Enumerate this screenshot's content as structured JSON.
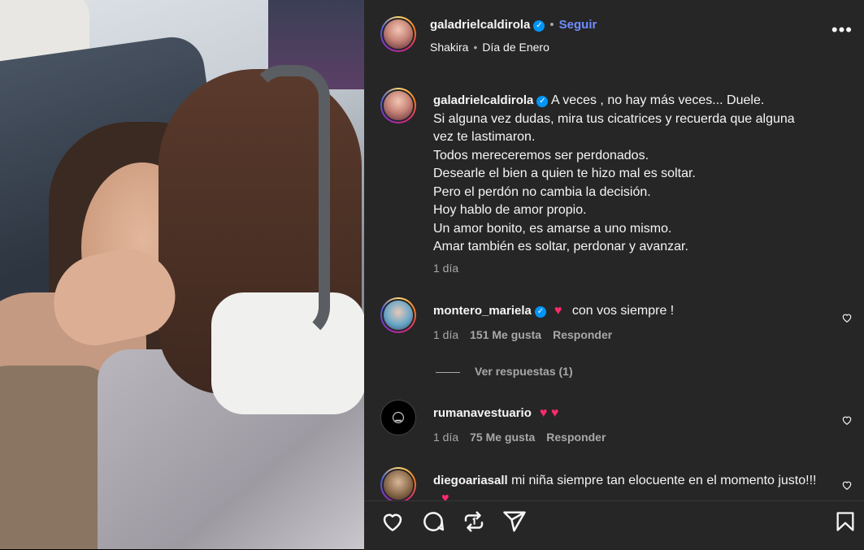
{
  "post": {
    "author": "galadrielcaldirola",
    "follow_label": "Seguir",
    "audio_artist": "Shakira",
    "audio_song": "Día de Enero",
    "more_label": "•••"
  },
  "caption": {
    "author": "galadrielcaldirola",
    "lines": [
      "A veces , no hay más veces... Duele.",
      "Si alguna vez dudas, mira tus cicatrices y recuerda que alguna",
      "vez te lastimaron.",
      "Todos mereceremos ser perdonados.",
      "Desearle el bien a quien te hizo mal es soltar.",
      "Pero el perdón no cambia la decisión.",
      "Hoy hablo de amor propio.",
      "Un amor bonito, es amarse a uno mismo.",
      "Amar también es soltar, perdonar y avanzar."
    ],
    "time": "1 día"
  },
  "comments": [
    {
      "author": "montero_mariela",
      "text": "con vos siempre !",
      "emoji": "♥",
      "time": "1 día",
      "likes": "151 Me gusta",
      "reply_label": "Responder"
    },
    {
      "author": "rumanavestuario",
      "text": "",
      "emoji": "♥ ♥",
      "time": "1 día",
      "likes": "75 Me gusta",
      "reply_label": "Responder"
    },
    {
      "author": "diegoariasall",
      "text": "mi niña siempre tan elocuente en el momento justo!!!",
      "emoji": "♥"
    }
  ],
  "view_replies_label": "Ver respuestas (1)",
  "colors": {
    "panel_bg": "#262626",
    "accent_blue": "#0095f6",
    "follow_blue": "#708dff",
    "muted": "#a8a8a8",
    "heart": "#ff2a6d"
  }
}
